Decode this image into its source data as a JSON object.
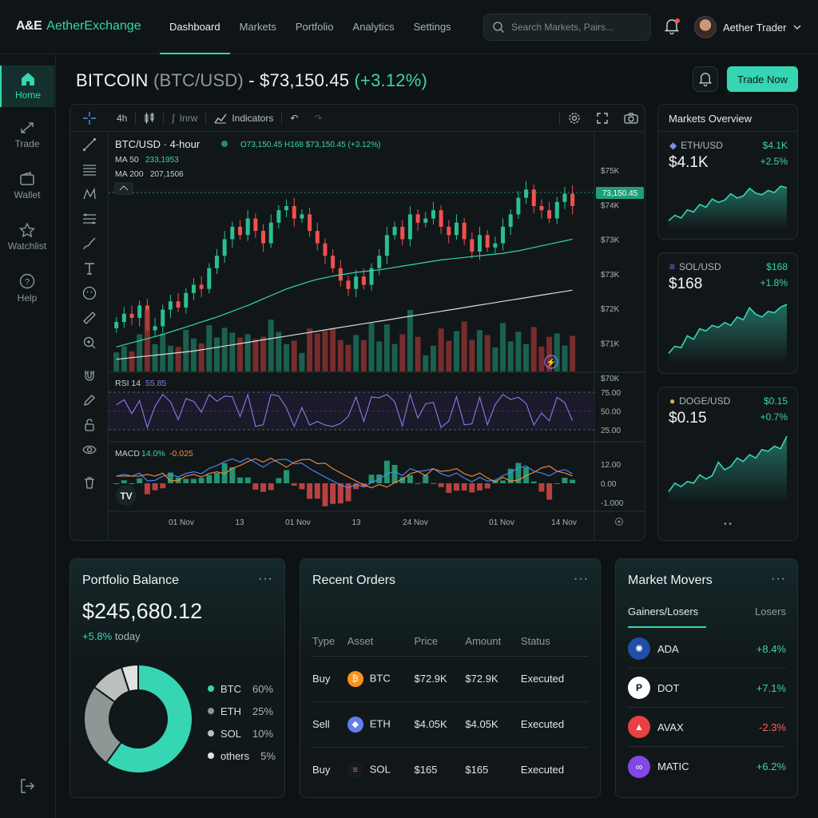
{
  "app": {
    "logo_mark": "A&E",
    "logo_name": "AetherExchange"
  },
  "nav": [
    {
      "label": "Dashboard",
      "active": true
    },
    {
      "label": "Markets"
    },
    {
      "label": "Portfolio"
    },
    {
      "label": "Analytics"
    },
    {
      "label": "Settings"
    }
  ],
  "search": {
    "placeholder": "Search Markets, Pairs..."
  },
  "user": {
    "name": "Aether Trader"
  },
  "sidebar": [
    {
      "label": "Home",
      "icon": "home-icon"
    },
    {
      "label": "Trade",
      "icon": "trade-icon"
    },
    {
      "label": "Wallet",
      "icon": "wallet-icon"
    },
    {
      "label": "Watchlist",
      "icon": "star-icon"
    },
    {
      "label": "Help",
      "icon": "help-icon"
    }
  ],
  "header": {
    "asset": "BITCOIN",
    "pair": "(BTC/USD)",
    "price": "- $73,150.45",
    "change": "(+3.12%)",
    "trade_button": "Trade Now"
  },
  "toolbar": {
    "interval": "4h",
    "chart_type": "Inrw",
    "indicators": "Indicators"
  },
  "chart": {
    "legend_title": "BTC/USD · 4-hour",
    "ohlc": "O73,150.45  H168  $73,150.45 (+3.12%)",
    "ma50_label": "MA 50",
    "ma50_value": "233,1953",
    "ma200_label": "MA 200",
    "ma200_value": "207,1506",
    "current_price": "73,150.45",
    "rsi_label": "RSI 14",
    "rsi_value": "55.85",
    "macd_label": "MACD",
    "macd_v1": "14.0%",
    "macd_v2": "-0.025",
    "watermark": "TV"
  },
  "chart_data": {
    "type": "candlestick",
    "price_axis_ticks": [
      "$75K",
      "$74K",
      "$73K",
      "$73K",
      "$72K",
      "$71K",
      "$70K"
    ],
    "rsi_axis_ticks": [
      "75.00",
      "50.00",
      "25.00"
    ],
    "macd_axis_ticks": [
      "12.00",
      "0.00",
      "-1.000"
    ],
    "x_axis_ticks": [
      "01 Nov",
      "13",
      "01 Nov",
      "13",
      "24 Nov",
      "01 Nov",
      "14 Nov"
    ],
    "close": [
      70800,
      71000,
      70900,
      71200,
      70600,
      70700,
      71100,
      71300,
      71150,
      71500,
      71700,
      71600,
      72100,
      72400,
      72800,
      73100,
      72900,
      73300,
      73000,
      72700,
      73200,
      73500,
      73600,
      73300,
      73400,
      73000,
      72700,
      72400,
      72100,
      71800,
      71600,
      71900,
      71700,
      72100,
      72400,
      72900,
      73100,
      72800,
      73400,
      73200,
      73300,
      73500,
      73100,
      72900,
      73200,
      72800,
      72500,
      72900,
      72600,
      72700,
      73100,
      73400,
      73800,
      74000,
      73600,
      73500,
      73300,
      73700,
      73900,
      73600
    ],
    "ma50": [
      70200,
      70250,
      70300,
      70350,
      70400,
      70450,
      70500,
      70560,
      70620,
      70680,
      70740,
      70800,
      70860,
      70920,
      70990,
      71060,
      71130,
      71200,
      71280,
      71360,
      71440,
      71520,
      71600,
      71660,
      71720,
      71780,
      71830,
      71870,
      71910,
      71940,
      71970,
      72000,
      72020,
      72040,
      72060,
      72090,
      72120,
      72150,
      72180,
      72210,
      72240,
      72270,
      72300,
      72320,
      72340,
      72360,
      72380,
      72400,
      72420,
      72440,
      72460,
      72490,
      72520,
      72560,
      72600,
      72640,
      72680,
      72720,
      72760,
      72800
    ],
    "ma200": [
      69900,
      69920,
      69940,
      69960,
      69980,
      70000,
      70020,
      70040,
      70060,
      70080,
      70100,
      70130,
      70160,
      70190,
      70220,
      70250,
      70280,
      70310,
      70340,
      70370,
      70400,
      70430,
      70460,
      70490,
      70520,
      70550,
      70580,
      70610,
      70640,
      70670,
      70700,
      70730,
      70760,
      70790,
      70820,
      70850,
      70880,
      70910,
      70940,
      70970,
      71000,
      71030,
      71060,
      71090,
      71120,
      71150,
      71180,
      71210,
      71240,
      71270,
      71300,
      71330,
      71360,
      71390,
      71420,
      71450,
      71480,
      71510,
      71540,
      71570
    ],
    "price_range": [
      69800,
      75200
    ],
    "rsi_range": [
      0,
      100
    ]
  },
  "markets_overview": {
    "title": "Markets Overview",
    "items": [
      {
        "symbol": "ETH/USD",
        "price": "$4.1K",
        "big": "$4.1K",
        "change": "+2.5%",
        "icon": "eth-icon",
        "spark": [
          3,
          4,
          3.5,
          5,
          4.6,
          6,
          5.5,
          7,
          6.4,
          6.8,
          8,
          7.2,
          7.6,
          9,
          8.1,
          7.8,
          8.6,
          8.2,
          9.4,
          9.1
        ]
      },
      {
        "symbol": "SOL/USD",
        "price": "$168",
        "big": "$168",
        "change": "+1.8%",
        "icon": "sol-icon",
        "spark": [
          2,
          3,
          2.8,
          4.5,
          4,
          5.5,
          5.2,
          6,
          5.7,
          6.4,
          6,
          7.2,
          6.8,
          8.5,
          7.6,
          7.2,
          8,
          7.8,
          8.6,
          9
        ]
      },
      {
        "symbol": "DOGE/USD",
        "price": "$0.15",
        "big": "$0.15",
        "change": "+0.7%",
        "icon": "doge-icon",
        "spark": [
          2,
          3,
          2.6,
          3.2,
          3,
          4,
          3.5,
          3.9,
          5.5,
          4.6,
          5,
          6,
          5.6,
          6.4,
          6,
          7,
          6.8,
          7.4,
          7.1,
          8.6
        ]
      }
    ],
    "pager": "• •"
  },
  "portfolio": {
    "title": "Portfolio Balance",
    "balance": "$245,680.12",
    "change": "+5.8%",
    "change_suffix": "today",
    "allocation": [
      {
        "name": "BTC",
        "pct": "60%",
        "value": 60,
        "color": "#36d5b3"
      },
      {
        "name": "ETH",
        "pct": "25%",
        "value": 25,
        "color": "#8e9795"
      },
      {
        "name": "SOL",
        "pct": "10%",
        "value": 10,
        "color": "#b9c0be"
      },
      {
        "name": "others",
        "pct": "5%",
        "value": 5,
        "color": "#dfe4e2"
      }
    ]
  },
  "orders": {
    "title": "Recent Orders",
    "columns": [
      "Type",
      "Asset",
      "Price",
      "Amount",
      "Status"
    ],
    "rows": [
      {
        "type": "Buy",
        "asset": "BTC",
        "price": "$72.9K",
        "amount": "$72.9K",
        "status": "Executed",
        "color": "#f7931a",
        "glyph": "₿"
      },
      {
        "type": "Sell",
        "asset": "ETH",
        "price": "$4.05K",
        "amount": "$4.05K",
        "status": "Executed",
        "color": "#627eea",
        "glyph": "◆"
      },
      {
        "type": "Buy",
        "asset": "SOL",
        "price": "$165",
        "amount": "$165",
        "status": "Executed",
        "color": "#1a1a1a",
        "glyph": "≡"
      }
    ]
  },
  "movers": {
    "title": "Market Movers",
    "tab_active": "Gainers/Losers",
    "tab_other": "Losers",
    "items": [
      {
        "name": "ADA",
        "change": "+8.4%",
        "dir": "up",
        "bg": "#1f4fa8",
        "glyph": "✺"
      },
      {
        "name": "DOT",
        "change": "+7.1%",
        "dir": "up",
        "bg": "#ffffff",
        "glyph": "P"
      },
      {
        "name": "AVAX",
        "change": "-2.3%",
        "dir": "down",
        "bg": "#e84142",
        "glyph": "▲"
      },
      {
        "name": "MATIC",
        "change": "+6.2%",
        "dir": "up",
        "bg": "#8247e5",
        "glyph": "∞"
      }
    ]
  }
}
